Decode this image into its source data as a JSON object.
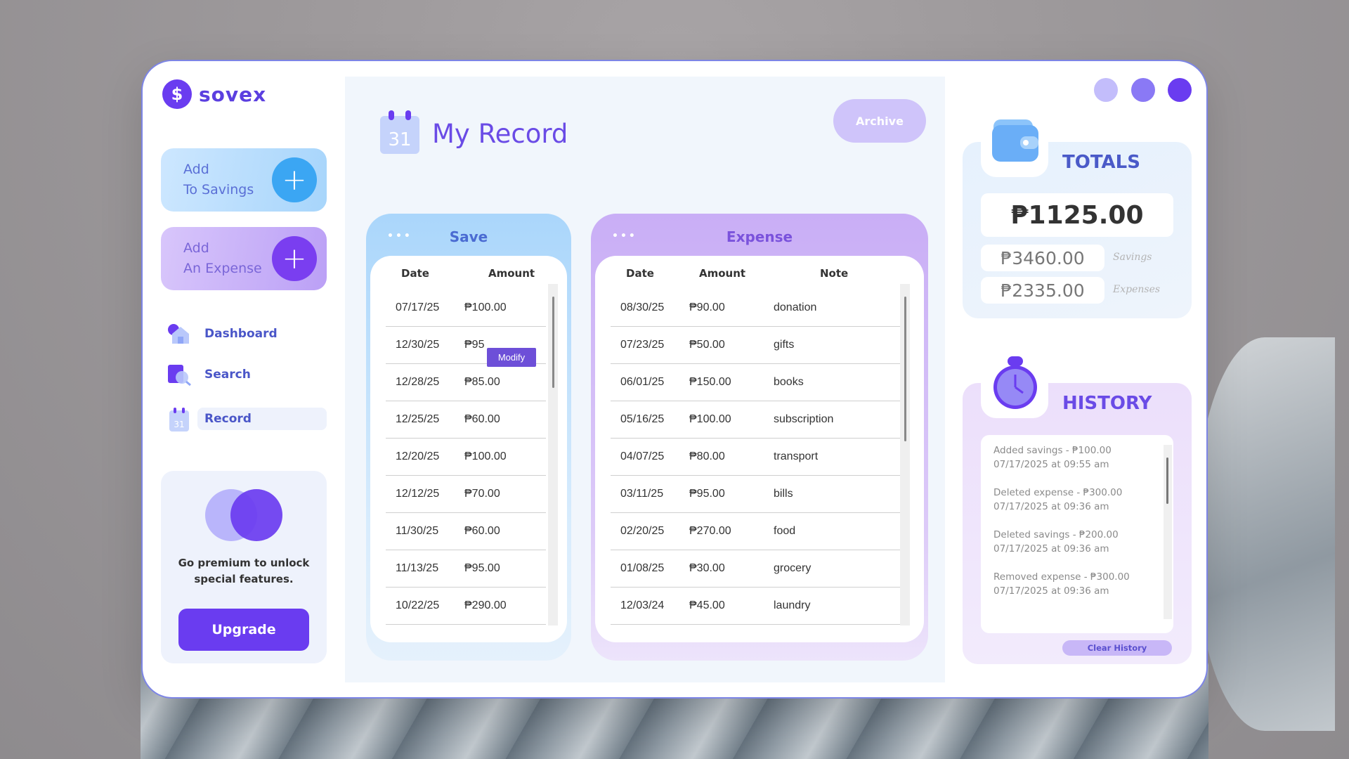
{
  "brand": {
    "logo_symbol": "$",
    "name": "sovex"
  },
  "sidebar": {
    "add_savings": {
      "line1": "Add",
      "line2": "To Savings",
      "plus": "+"
    },
    "add_expense": {
      "line1": "Add",
      "line2": "An Expense",
      "plus": "+"
    },
    "nav": [
      {
        "label": "Dashboard",
        "icon": "home-icon"
      },
      {
        "label": "Search",
        "icon": "search-icon"
      },
      {
        "label": "Record",
        "icon": "calendar-icon",
        "calendar_number": "31",
        "active": true
      }
    ],
    "premium": {
      "text": "Go premium to unlock special features.",
      "button": "Upgrade"
    }
  },
  "main": {
    "title": "My Record",
    "calendar_number": "31",
    "archive_button": "Archive",
    "save_table": {
      "title": "Save",
      "menu_dots": "•••",
      "columns": [
        "Date",
        "Amount"
      ],
      "rows": [
        [
          "07/17/25",
          "₱100.00"
        ],
        [
          "12/30/25",
          "₱95"
        ],
        [
          "12/28/25",
          "₱85.00"
        ],
        [
          "12/25/25",
          "₱60.00"
        ],
        [
          "12/20/25",
          "₱100.00"
        ],
        [
          "12/12/25",
          "₱70.00"
        ],
        [
          "11/30/25",
          "₱60.00"
        ],
        [
          "11/13/25",
          "₱95.00"
        ],
        [
          "10/22/25",
          "₱290.00"
        ]
      ],
      "modify_button": "Modify"
    },
    "expense_table": {
      "title": "Expense",
      "menu_dots": "•••",
      "columns": [
        "Date",
        "Amount",
        "Note"
      ],
      "rows": [
        [
          "08/30/25",
          "₱90.00",
          "donation"
        ],
        [
          "07/23/25",
          "₱50.00",
          "gifts"
        ],
        [
          "06/01/25",
          "₱150.00",
          "books"
        ],
        [
          "05/16/25",
          "₱100.00",
          "subscription"
        ],
        [
          "04/07/25",
          "₱80.00",
          "transport"
        ],
        [
          "03/11/25",
          "₱95.00",
          "bills"
        ],
        [
          "02/20/25",
          "₱270.00",
          "food"
        ],
        [
          "01/08/25",
          "₱30.00",
          "grocery"
        ],
        [
          "12/03/24",
          "₱45.00",
          "laundry"
        ]
      ]
    }
  },
  "totals": {
    "title": "TOTALS",
    "total": "₱1125.00",
    "savings_value": "₱3460.00",
    "savings_label": "Savings",
    "expenses_value": "₱2335.00",
    "expenses_label": "Expenses"
  },
  "history": {
    "title": "HISTORY",
    "items": [
      {
        "action": "Added savings - ₱100.00",
        "time": "07/17/2025 at 09:55 am"
      },
      {
        "action": "Deleted expense - ₱300.00",
        "time": "07/17/2025 at 09:36 am"
      },
      {
        "action": "Deleted savings - ₱200.00",
        "time": "07/17/2025 at 09:36 am"
      },
      {
        "action": "Removed expense - ₱300.00",
        "time": "07/17/2025 at 09:36 am"
      }
    ],
    "clear_button": "Clear History"
  },
  "colors": {
    "accent": "#6a3cf0",
    "window_dot_1": "#c3bdfb",
    "window_dot_2": "#8a79f5",
    "window_dot_3": "#6a3cf0"
  }
}
